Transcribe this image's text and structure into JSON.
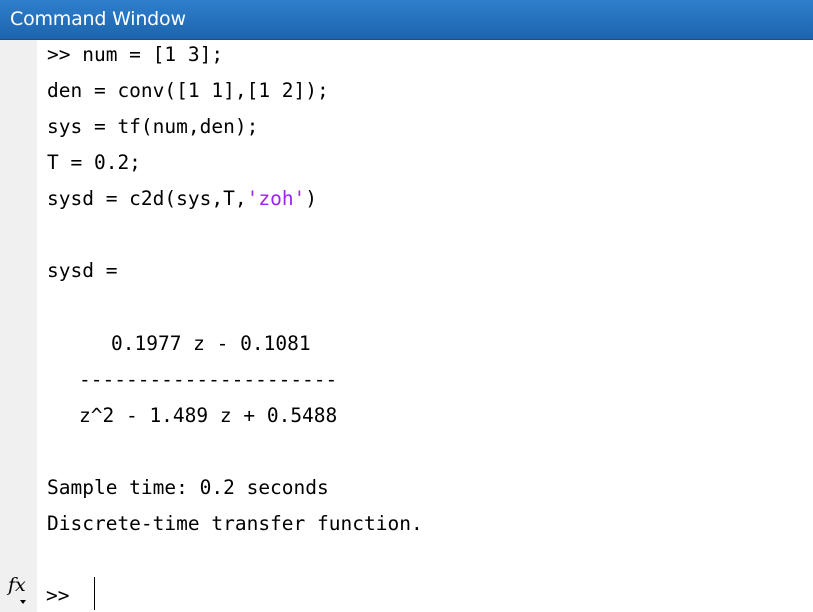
{
  "window": {
    "title": "Command Window"
  },
  "command_lines": [
    ">> num = [1 3];",
    "den = conv([1 1],[1 2]);",
    "sys = tf(num,den);",
    "T = 0.2;"
  ],
  "last_command": {
    "before": "sysd = c2d(sys,T,",
    "string_arg": "'zoh'",
    "after": ")"
  },
  "output": {
    "var_header": "sysd =",
    "numerator": "0.1977 z - 0.1081",
    "fraction_bar": "----------------------",
    "denominator": "z^2 - 1.489 z + 0.5488",
    "sample_time": "Sample time: 0.2 seconds",
    "description": "Discrete-time transfer function."
  },
  "prompt": {
    "fx_label": "fx",
    "symbol": ">>"
  },
  "colors": {
    "titlebar": "#1d64ad",
    "string_literal": "#a020f0",
    "gutter": "#f0f0f0"
  }
}
